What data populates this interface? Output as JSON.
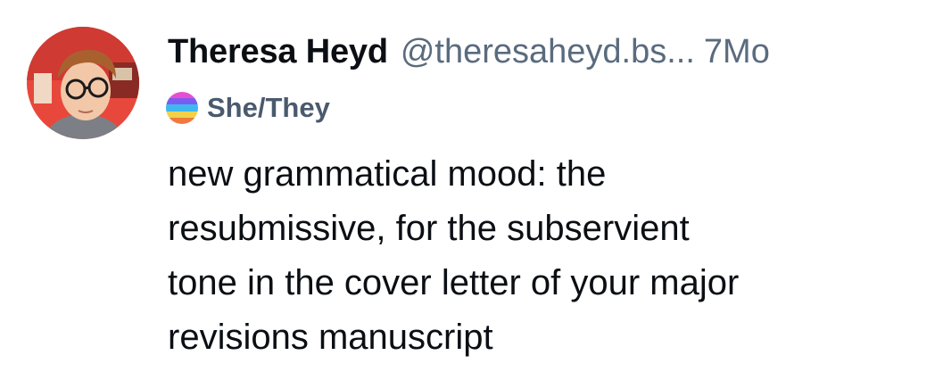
{
  "author": {
    "display_name": "Theresa Heyd",
    "handle": "@theresaheyd.bs...",
    "pronouns": "She/They",
    "timestamp": "7Mo"
  },
  "avatar_icon": "avatar-photo",
  "pronoun_badge_icon": "pronoun-pride-badge",
  "post": {
    "lines": [
      "new grammatical mood: the",
      "resubmissive, for the subservient",
      "tone in the cover letter of your major",
      "revisions manuscript"
    ]
  },
  "colors": {
    "name": "#0b0f14",
    "secondary": "#5a6b7e",
    "pronouns": "#4a5a6e",
    "background": "#ffffff"
  }
}
